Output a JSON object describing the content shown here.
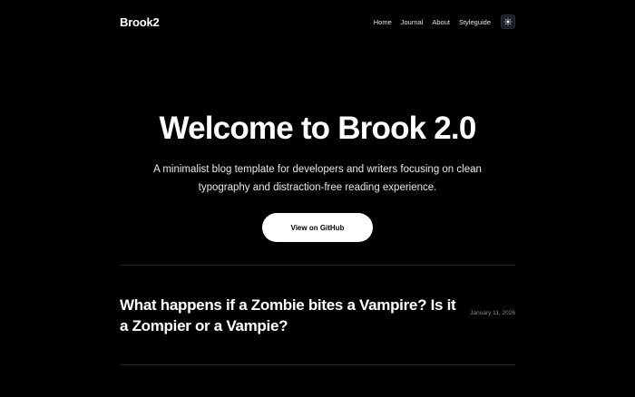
{
  "site": {
    "brand": "Brook2"
  },
  "nav": {
    "items": [
      {
        "label": "Home"
      },
      {
        "label": "Journal"
      },
      {
        "label": "About"
      },
      {
        "label": "Styleguide"
      }
    ],
    "theme_toggle_icon": "sun-icon"
  },
  "hero": {
    "title": "Welcome to Brook 2.0",
    "subtitle": "A minimalist blog template for developers and writers focusing on clean typography and distraction-free reading experience.",
    "cta_label": "View on GitHub"
  },
  "posts": [
    {
      "title": "What happens if a Zombie bites a Vampire? Is it a Zompier or a Vampie?",
      "date": "January 11, 2026"
    }
  ],
  "colors": {
    "background": "#000000",
    "text": "#ffffff",
    "muted": "#8a8a8a",
    "button_bg": "#ffffff",
    "button_text": "#000000",
    "toggle_bg": "#1c1f29"
  }
}
